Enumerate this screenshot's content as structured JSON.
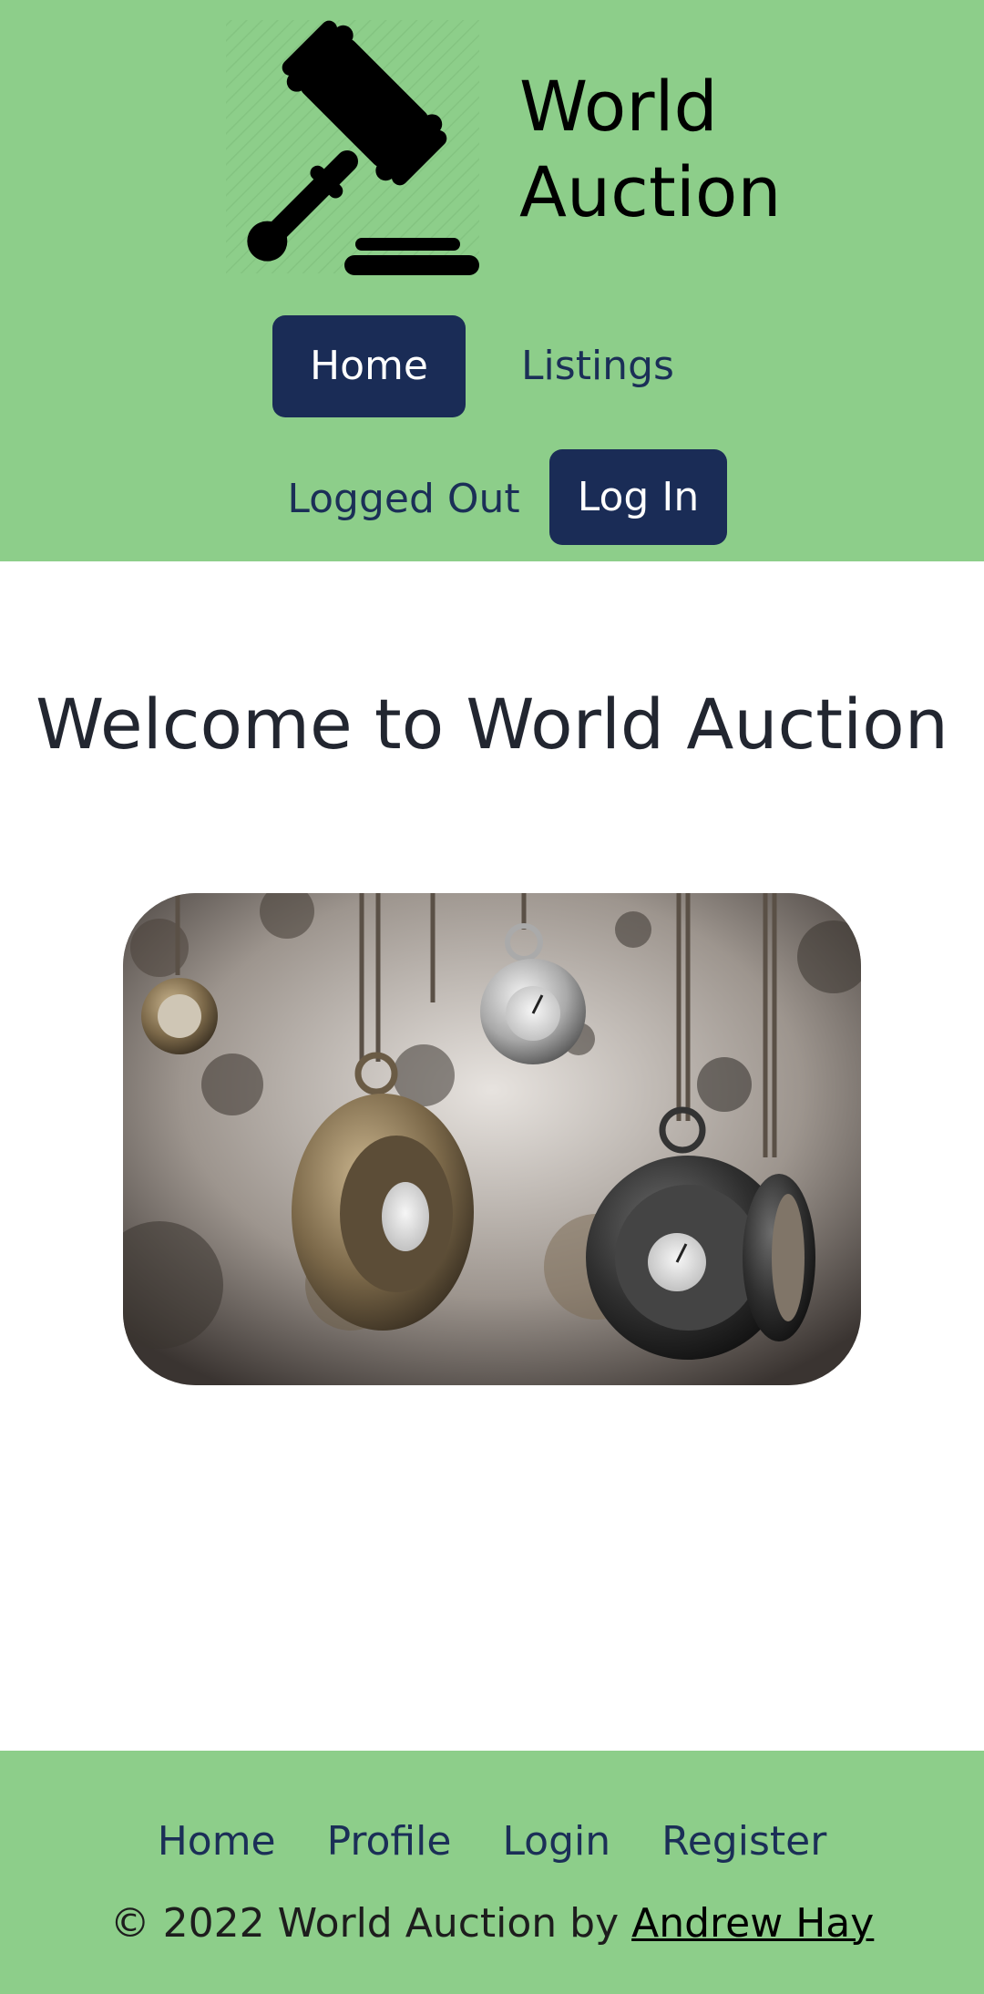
{
  "header": {
    "brand": {
      "line1": "World",
      "line2": "Auction",
      "logo_icon": "gavel-icon"
    },
    "nav": [
      {
        "label": "Home",
        "active": true
      },
      {
        "label": "Listings",
        "active": false
      }
    ],
    "auth": {
      "status": "Logged Out",
      "login_label": "Log In"
    }
  },
  "main": {
    "title": "Welcome to World Auction",
    "hero_image": "pocket-watches-photo"
  },
  "footer": {
    "links": [
      {
        "label": "Home"
      },
      {
        "label": "Profile"
      },
      {
        "label": "Login"
      },
      {
        "label": "Register"
      }
    ],
    "copyright_prefix": "© 2022 World Auction by ",
    "author": "Andrew Hay"
  },
  "colors": {
    "header_bg": "#8dce8a",
    "button_bg": "#1a2c56",
    "nav_text": "#1b2f57",
    "heading_text": "#222630"
  }
}
